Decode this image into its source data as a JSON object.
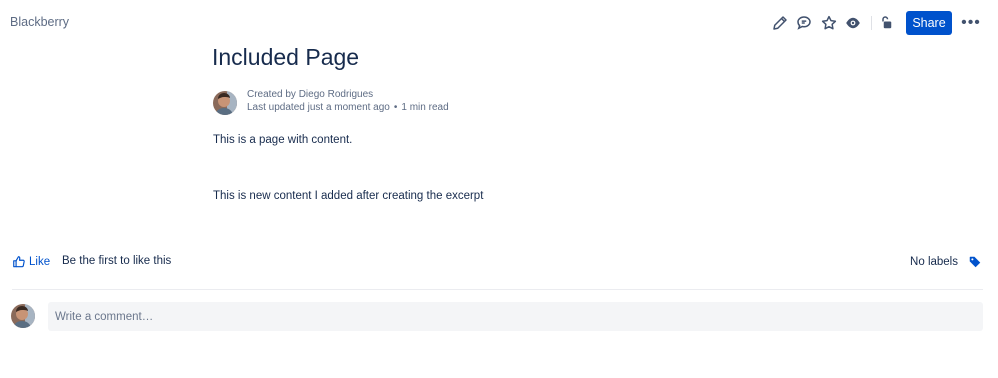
{
  "breadcrumb": {
    "space": "Blackberry"
  },
  "toolbar": {
    "icons": [
      "edit-icon",
      "comment-icon",
      "star-icon",
      "watch-icon",
      "restrictions-icon"
    ],
    "share_label": "Share",
    "more_label": "•••"
  },
  "page": {
    "title": "Included Page",
    "byline": {
      "created": "Created by Diego Rodrigues",
      "updated": "Last updated just a moment ago",
      "separator": "•",
      "read_time": "1 min read"
    },
    "content": [
      "This is a page with content.",
      "This is new content I added after creating the excerpt"
    ]
  },
  "footer": {
    "like_label": "Like",
    "like_prompt": "Be the first to like this",
    "labels_text": "No labels"
  },
  "comment": {
    "placeholder": "Write a comment…"
  },
  "colors": {
    "primary": "#0052cc",
    "text": "#172b4d",
    "subtle": "#5e6c84",
    "input_bg": "#f4f5f7"
  }
}
